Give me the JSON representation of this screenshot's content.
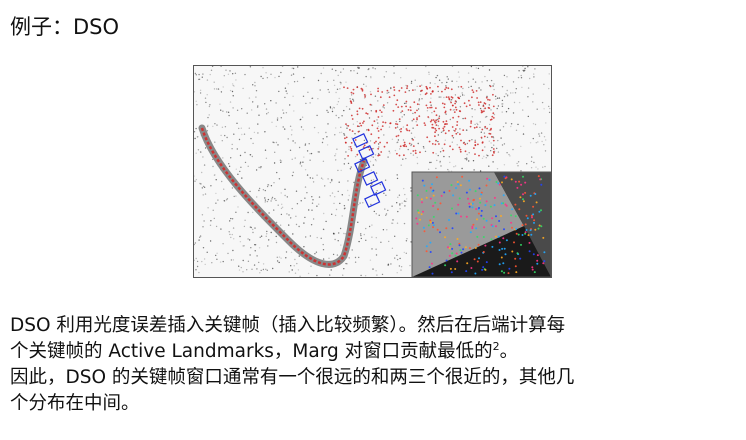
{
  "slide": {
    "title": "例子：DSO",
    "paragraph1": {
      "line1": "DSO 利用光度误差插入关键帧（插入比较频繁）。然后在后端计算每",
      "line2": "个关键帧的 Active Landmarks，Marg 对窗口贡献最低的",
      "footnote_mark": "2",
      "line2_end": "。"
    },
    "paragraph2": {
      "line1": "因此，DSO 的关键帧窗口通常有一个很远的和两三个很近的，其他几",
      "line2": "个分布在中间。"
    }
  },
  "figure": {
    "icon": "dso-point-cloud-figure",
    "colors": {
      "cloud": "#3a3a3a",
      "points_red": "#cc2222",
      "keyframes_blue": "#2233dd",
      "trajectory": "#cc3333"
    }
  }
}
